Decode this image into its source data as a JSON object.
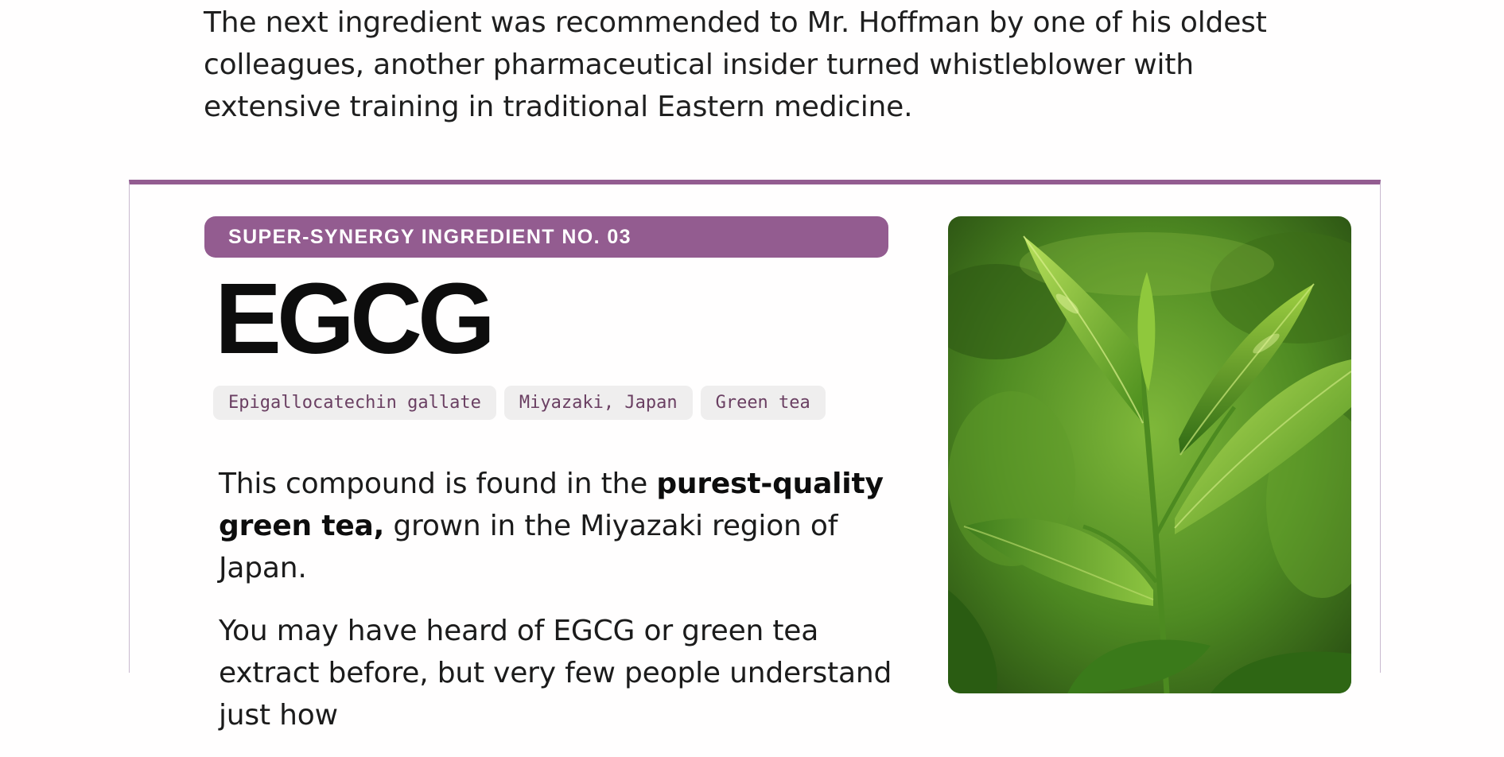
{
  "intro": {
    "text": "The next ingredient was recommended to Mr. Hoffman by one of his oldest colleagues, another pharmaceutical insider turned whistleblower with extensive training in traditional Eastern medicine."
  },
  "ingredient": {
    "badge": "SUPER-SYNERGY INGREDIENT NO. 03",
    "name": "EGCG",
    "tags": [
      "Epigallocatechin gallate",
      "Miyazaki, Japan",
      "Green tea"
    ],
    "para1": {
      "pre": "This compound is found in the ",
      "bold": "purest-quality green tea,",
      "post": " grown in the Miyazaki region of Japan."
    },
    "para2": "You may have heard of EGCG or green tea extract before, but very few people understand just how",
    "image_subject": "green-tea-leaves"
  },
  "colors": {
    "accent": "#935c90",
    "tag_bg": "#efeeee",
    "tag_text": "#6a3f62"
  }
}
